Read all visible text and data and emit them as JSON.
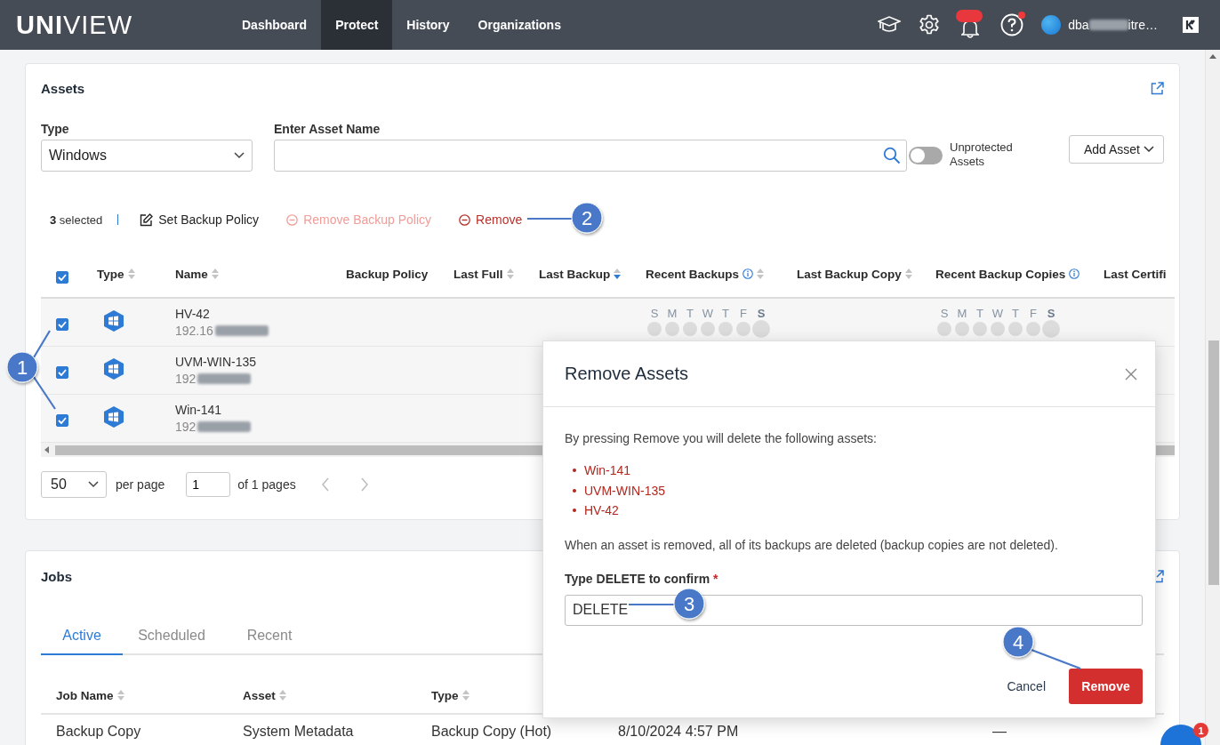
{
  "header": {
    "logo": "**UNI**VIEW",
    "nav": [
      {
        "label": "Dashboard",
        "selected": false
      },
      {
        "label": "Protect",
        "selected": true
      },
      {
        "label": "History",
        "selected": false
      },
      {
        "label": "Organizations",
        "selected": false
      }
    ],
    "notifications_badge": true,
    "help_alert": true,
    "user": {
      "name_start": "dba",
      "name_end": "itre…"
    }
  },
  "assets": {
    "title": "Assets",
    "type_filter": {
      "label": "Type",
      "value": "Windows"
    },
    "name_filter": {
      "label": "Enter Asset Name"
    },
    "unprotected_toggle": {
      "label": "Unprotected Assets",
      "on": false
    },
    "add_button": "Add Asset",
    "selection": {
      "count": "**3** selected",
      "actions": [
        {
          "label": "Set Backup Policy",
          "kind": "edit",
          "disabled": false
        },
        {
          "label": "Remove Backup Policy",
          "kind": "remove",
          "disabled": true
        },
        {
          "label": "Remove",
          "kind": "remove",
          "disabled": false
        }
      ]
    },
    "table": {
      "all_checked": true,
      "columns": [
        {
          "label": "Type",
          "sortable": true
        },
        {
          "label": "Name",
          "sortable": true
        },
        {
          "label": "Backup Policy"
        },
        {
          "label": "Last Full",
          "sortable": true
        },
        {
          "label": "Last Backup",
          "sortable": true,
          "sorted_desc": true
        },
        {
          "label": "Recent Backups",
          "info": true,
          "sortable": true
        },
        {
          "label": "Last Backup Copy",
          "sortable": true
        },
        {
          "label": "Recent Backup Copies",
          "info": true
        },
        {
          "label": "Last Certifi"
        }
      ],
      "rows": [
        {
          "checked": true,
          "name": "HV-42",
          "address": "192.16",
          "recent_backups": [
            {
              "label": "S",
              "today": false
            },
            {
              "label": "M",
              "today": false
            },
            {
              "label": "T",
              "today": false
            },
            {
              "label": "W",
              "today": false
            },
            {
              "label": "T",
              "today": false
            },
            {
              "label": "F",
              "today": false
            },
            {
              "label": "S",
              "today": true
            }
          ],
          "recent_backup_copies": [
            {
              "label": "S",
              "today": false
            },
            {
              "label": "M",
              "today": false
            },
            {
              "label": "T",
              "today": false
            },
            {
              "label": "W",
              "today": false
            },
            {
              "label": "T",
              "today": false
            },
            {
              "label": "F",
              "today": false
            },
            {
              "label": "S",
              "today": true
            }
          ]
        },
        {
          "checked": true,
          "name": "UVM-WIN-135",
          "address": "192"
        },
        {
          "checked": true,
          "name": "Win-141",
          "address": "192"
        }
      ]
    },
    "pagination": {
      "per_page": "50",
      "per_page_label": "per page",
      "page": "1",
      "of_pages": "of 1 pages"
    }
  },
  "jobs": {
    "title": "Jobs",
    "tabs": [
      {
        "label": "Active",
        "selected": true
      },
      {
        "label": "Scheduled",
        "selected": false
      },
      {
        "label": "Recent",
        "selected": false
      }
    ],
    "columns": [
      {
        "label": "Job Name"
      },
      {
        "label": "Asset"
      },
      {
        "label": "Type"
      }
    ],
    "rows": [
      {
        "job_name": "Backup Copy",
        "asset": "System Metadata",
        "type": "Backup Copy (Hot)",
        "started": "8/10/2024 4:57 PM",
        "status": "—"
      }
    ]
  },
  "modal": {
    "title": "Remove Assets",
    "intro": "By pressing Remove you will delete the following assets:",
    "assets": [
      "Win-141",
      "UVM-WIN-135",
      "HV-42"
    ],
    "note": "When an asset is removed, all of its backups are deleted (backup copies are not deleted).",
    "confirm_label": "Type DELETE to confirm",
    "required_mark": "*",
    "confirm_value": "DELETE",
    "cancel": "Cancel",
    "remove": "Remove"
  },
  "annotations": [
    "1",
    "2",
    "3",
    "4"
  ],
  "chat": {
    "badge": "1"
  }
}
